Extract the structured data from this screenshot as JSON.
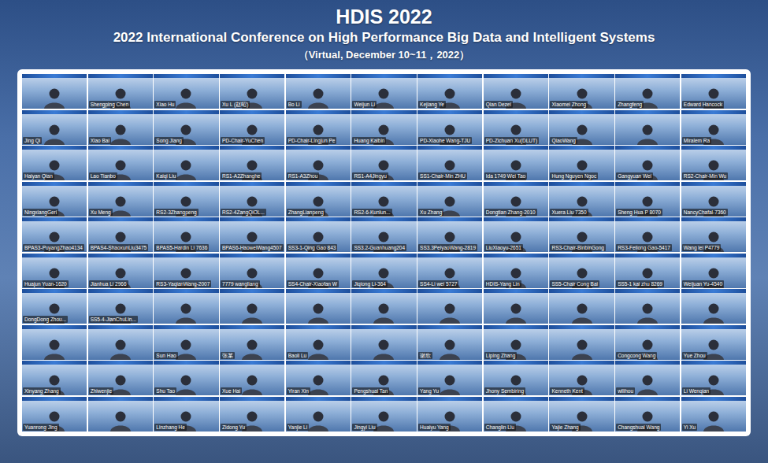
{
  "banner": {
    "title": "HDIS 2022",
    "subtitle": "2022 International Conference on High Performance Big Data and Intelligent Systems",
    "dates": "（Virtual, December 10~11，2022）"
  },
  "participants": [
    {
      "name": ""
    },
    {
      "name": "Shengping Chen"
    },
    {
      "name": "Xiao Hu"
    },
    {
      "name": "Xu L (赵昭)"
    },
    {
      "name": "Bo Li"
    },
    {
      "name": "Weijun Li"
    },
    {
      "name": "Kejiang Ye"
    },
    {
      "name": "Qian Dezei"
    },
    {
      "name": "Xiaomei Zhong"
    },
    {
      "name": "Zhangfeng"
    },
    {
      "name": "Edward Hancock"
    },
    {
      "name": "Jing Qi"
    },
    {
      "name": "Xiao Bai"
    },
    {
      "name": "Song Jiang"
    },
    {
      "name": "PD-Chair-YuChen"
    },
    {
      "name": "PD-Chair-Lingjun Pe"
    },
    {
      "name": "Huang Kaibin"
    },
    {
      "name": "PD-Xiaohe Wang-TJU"
    },
    {
      "name": "PD-Zichuan Xu(DLUT)"
    },
    {
      "name": "QiaoWang"
    },
    {
      "name": ""
    },
    {
      "name": "Miralem Ra"
    },
    {
      "name": "Haiyan Qian"
    },
    {
      "name": "Lao Tianbo"
    },
    {
      "name": "Kaiqi Liu"
    },
    {
      "name": "RS1-A2Zhanghe"
    },
    {
      "name": "RS1-A3Zhou"
    },
    {
      "name": "RS1-A4Jingyu"
    },
    {
      "name": "SS1-Chair-Min ZHU"
    },
    {
      "name": "Ida 1749 Wei Tao"
    },
    {
      "name": "Hung Nguyen Ngoc"
    },
    {
      "name": "Gangyuan Wei"
    },
    {
      "name": "RS2-Chair-Min Wu"
    },
    {
      "name": "NingxiangGeri"
    },
    {
      "name": "Xu Meng"
    },
    {
      "name": "RS2-3Zhangpeng"
    },
    {
      "name": "RS2-4ZangQiOL..."
    },
    {
      "name": "ZhangLianpeng"
    },
    {
      "name": "RS2-6-Kunlun..."
    },
    {
      "name": "Xu Zhang"
    },
    {
      "name": "Dongtian Zhang-2010"
    },
    {
      "name": "Xuera Liu 7350"
    },
    {
      "name": "Sheng Hua P 8070"
    },
    {
      "name": "NancyChafal-7360"
    },
    {
      "name": "BPAS3-PuyangZhao4134"
    },
    {
      "name": "BPAS4-ShaoxunLiu3475"
    },
    {
      "name": "BPAS5-Hardin Li 7636"
    },
    {
      "name": "BPAS6-HaoweiWang4507"
    },
    {
      "name": "SS3-1-Qing Gao 843"
    },
    {
      "name": "SS3.2-Guanhuang204"
    },
    {
      "name": "SS3.3PeiyaoWang-2819"
    },
    {
      "name": "LiuXiaoyu-2651"
    },
    {
      "name": "RS3-Chair-BinbinGong"
    },
    {
      "name": "RS3-Feilong Gao-5417"
    },
    {
      "name": "Wang lei P4779"
    },
    {
      "name": "Huajun Yuan-1620"
    },
    {
      "name": "Jianhua Li 2966"
    },
    {
      "name": "RS3-YaqianWang-2007"
    },
    {
      "name": "7779 wangliang"
    },
    {
      "name": "SS4-Chair-Xiaofan W"
    },
    {
      "name": "Jiqiong Li-364"
    },
    {
      "name": "SS4-Li wei 5727"
    },
    {
      "name": "HDIS-Yang Lin"
    },
    {
      "name": "SS5-Chair Cong Bai"
    },
    {
      "name": "SS5-1 kai zhu 8269"
    },
    {
      "name": "Weijuan Yu-4540"
    },
    {
      "name": "DongDong Zhou..."
    },
    {
      "name": "SS5-4-JianChuLin..."
    },
    {
      "name": ""
    },
    {
      "name": ""
    },
    {
      "name": ""
    },
    {
      "name": ""
    },
    {
      "name": ""
    },
    {
      "name": ""
    },
    {
      "name": ""
    },
    {
      "name": ""
    },
    {
      "name": ""
    },
    {
      "name": ""
    },
    {
      "name": ""
    },
    {
      "name": "Sun Hao"
    },
    {
      "name": "张某"
    },
    {
      "name": "Baoli Lu"
    },
    {
      "name": ""
    },
    {
      "name": "谢欣"
    },
    {
      "name": "Liping Zhang"
    },
    {
      "name": ""
    },
    {
      "name": "Congcong Wang"
    },
    {
      "name": "Yue Zhou"
    },
    {
      "name": "Xinyang Zhang"
    },
    {
      "name": "Zhiwenjie"
    },
    {
      "name": "Shu Tao"
    },
    {
      "name": "Xue Hai"
    },
    {
      "name": "Yiran Xin"
    },
    {
      "name": "Pengshuai Tan"
    },
    {
      "name": "Yang Yu"
    },
    {
      "name": "Jhony Sembiring"
    },
    {
      "name": "Kenneth Kent"
    },
    {
      "name": "wllihou"
    },
    {
      "name": "Li Wenqian"
    },
    {
      "name": "Yuanrong Jing"
    },
    {
      "name": ""
    },
    {
      "name": "Linzhang He"
    },
    {
      "name": "Zidong Yu"
    },
    {
      "name": "Yanjie Li"
    },
    {
      "name": "Jingyi Liu"
    },
    {
      "name": "Huaiyu Yang"
    },
    {
      "name": "Changlin Liu"
    },
    {
      "name": "Yajie Zhang"
    },
    {
      "name": "Changshuai Wang"
    },
    {
      "name": "Yi Xu"
    }
  ]
}
